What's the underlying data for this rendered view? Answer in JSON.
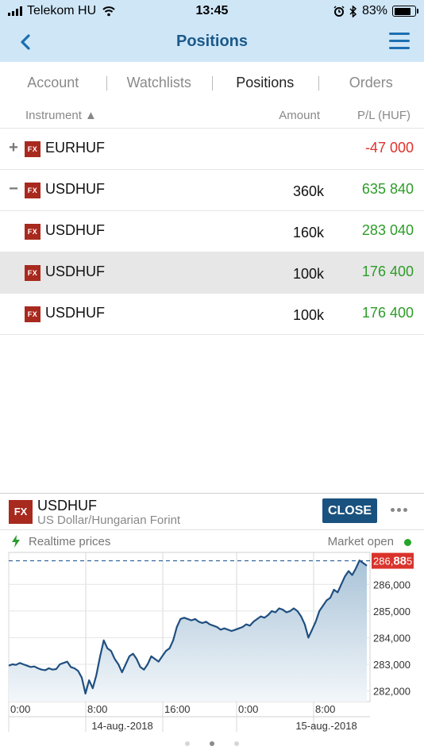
{
  "status_bar": {
    "carrier": "Telekom HU",
    "time": "13:45",
    "battery_percent": "83%",
    "battery_level": 0.83,
    "icons": [
      "signal-icon",
      "wifi-icon",
      "alarm-icon",
      "bluetooth-icon",
      "battery-icon"
    ]
  },
  "header": {
    "title": "Positions",
    "back_icon": "chevron-left-icon",
    "menu_icon": "hamburger-menu-icon",
    "color": "#1c5a8a",
    "background": "#cfe6f7"
  },
  "tabs": [
    {
      "label": "Account",
      "active": false
    },
    {
      "label": "Watchlists",
      "active": false
    },
    {
      "label": "Positions",
      "active": true
    },
    {
      "label": "Orders",
      "active": false
    }
  ],
  "table": {
    "col_instrument": "Instrument ▲",
    "col_amount": "Amount",
    "col_pl": "P/L (HUF)",
    "badge": "FX",
    "rows": [
      {
        "toggle": "+",
        "name": "EURHUF",
        "amount": "",
        "pl": "-47 000",
        "pl_sign": "neg",
        "selected": false
      },
      {
        "toggle": "−",
        "name": "USDHUF",
        "amount": "360k",
        "pl": "635 840",
        "pl_sign": "pos",
        "selected": false
      },
      {
        "toggle": "",
        "name": "USDHUF",
        "amount": "160k",
        "pl": "283 040",
        "pl_sign": "pos",
        "selected": false
      },
      {
        "toggle": "",
        "name": "USDHUF",
        "amount": "100k",
        "pl": "176 400",
        "pl_sign": "pos",
        "selected": true
      },
      {
        "toggle": "",
        "name": "USDHUF",
        "amount": "100k",
        "pl": "176 400",
        "pl_sign": "pos",
        "selected": false
      }
    ]
  },
  "panel": {
    "badge": "FX",
    "symbol": "USDHUF",
    "description": "US Dollar/Hungarian Forint",
    "close_label": "CLOSE",
    "more_icon": "more-dots-icon",
    "realtime_label": "Realtime prices",
    "realtime_icon": "lightning-icon",
    "market_status": "Market open",
    "market_status_color": "#27a52a"
  },
  "chart_data": {
    "type": "area",
    "x_ticks": [
      "0:00",
      "8:00",
      "16:00",
      "0:00",
      "8:00"
    ],
    "date_labels": [
      "14-aug.-2018",
      "15-aug.-2018"
    ],
    "y_ticks": [
      "286,000",
      "285,000",
      "284,000",
      "283,000",
      "282,000"
    ],
    "ylim": [
      281.6,
      287.2
    ],
    "current_price": {
      "prefix": "286,",
      "big": "88",
      "suffix": "5",
      "value": 286.885
    },
    "grid": true,
    "line_color": "#1f4f80",
    "fill_color": "#c9dbe8",
    "series": [
      {
        "values": [
          282.95,
          283.0,
          282.98,
          283.05,
          283.0,
          282.95,
          282.9,
          282.92,
          282.85,
          282.8,
          282.78,
          282.85,
          282.8,
          282.82,
          283.0,
          283.05,
          283.1,
          282.9,
          282.85,
          282.75,
          282.5,
          281.9,
          282.4,
          282.1,
          282.6,
          283.3,
          283.9,
          283.6,
          283.5,
          283.2,
          283.0,
          282.7,
          283.0,
          283.3,
          283.4,
          283.2,
          282.9,
          282.8,
          283.0,
          283.3,
          283.2,
          283.1,
          283.3,
          283.5,
          283.6,
          283.9,
          284.4,
          284.7,
          284.75,
          284.7,
          284.65,
          284.7,
          284.6,
          284.55,
          284.6,
          284.5,
          284.45,
          284.4,
          284.3,
          284.35,
          284.3,
          284.25,
          284.3,
          284.35,
          284.4,
          284.5,
          284.45,
          284.6,
          284.7,
          284.8,
          284.75,
          284.85,
          285.0,
          284.95,
          285.1,
          285.05,
          284.95,
          285.0,
          285.1,
          285.0,
          284.8,
          284.5,
          284.0,
          284.3,
          284.6,
          285.0,
          285.2,
          285.4,
          285.5,
          285.8,
          285.7,
          286.0,
          286.3,
          286.5,
          286.35,
          286.6,
          286.9,
          286.8,
          286.7
        ]
      }
    ]
  },
  "pager": {
    "count": 3,
    "active": 1
  }
}
